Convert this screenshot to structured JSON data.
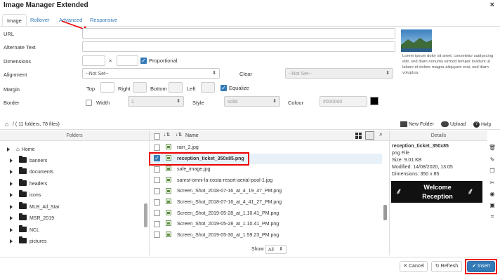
{
  "window": {
    "title": "Image Manager Extended",
    "close": "×"
  },
  "tabs": [
    {
      "label": "Image"
    },
    {
      "label": "Rollover"
    },
    {
      "label": "Advanced"
    },
    {
      "label": "Responsive"
    }
  ],
  "form": {
    "url_label": "URL",
    "alt_label": "Alternate Text",
    "dimensions_label": "Dimensions",
    "dim_separator": "×",
    "proportional_label": "Proportional",
    "alignment_label": "Alignment",
    "alignment_value": "--Not Set--",
    "clear_label": "Clear",
    "clear_value": "--Not Set--",
    "margin_label": "Margin",
    "margin_top": "Top",
    "margin_right": "Right",
    "margin_bottom": "Bottom",
    "margin_left": "Left",
    "equalize_label": "Equalize",
    "border_label": "Border",
    "width_label": "Width",
    "width_value": "1",
    "style_label": "Style",
    "style_value": "solid",
    "colour_label": "Colour",
    "colour_value": "#000000",
    "colour_swatch": "#000000"
  },
  "preview": {
    "text": "Lorem ipsum dolor sit amet, consetetur sadipscing elitr, sed diam nonumy eirmod tempor invidunt ut labore et dolore magna aliquyam erat, sed diam voluptua."
  },
  "browser": {
    "path": "/ ( 11 folders, 78 files)",
    "new_folder": "New Folder",
    "upload": "Upload",
    "help": "Help",
    "folders_header": "Folders",
    "name_header": "Name",
    "details_header": "Details",
    "show_label": "Show",
    "show_value": "All"
  },
  "folders": [
    {
      "label": "Home"
    },
    {
      "label": "banners"
    },
    {
      "label": "documents"
    },
    {
      "label": "headers"
    },
    {
      "label": "icons"
    },
    {
      "label": "MLB_All_Star"
    },
    {
      "label": "MSR_2019"
    },
    {
      "label": "NCL"
    },
    {
      "label": "pictures"
    }
  ],
  "files": [
    {
      "name": "rain_2.jpg"
    },
    {
      "name": "reception_ticket_350x85.png"
    },
    {
      "name": "safe_image.jpg"
    },
    {
      "name": "sanrst-omni-la-costa-resort-aerial-pool-1.jpg"
    },
    {
      "name": "Screen_Shot_2018-07-16_at_4_19_47_PM.png"
    },
    {
      "name": "Screen_Shot_2018-07-16_at_4_41_27_PM.png"
    },
    {
      "name": "Screen_Shot_2019-05-28_at_1.10.41_PM.png"
    },
    {
      "name": "Screen_Shot_2019-05-28_at_1.10.41_PM.png"
    },
    {
      "name": "Screen_Shot_2019-05-30_at_1.59.23_PM.png"
    }
  ],
  "details": {
    "filename": "reception_ticket_350x85",
    "type": "png File",
    "size": "Size: 9.01 KB",
    "modified": "Modified: 14/08/2020, 13:05",
    "dimensions": "Dimensions: 350 x 85",
    "thumb_line1": "Welcome",
    "thumb_line2": "Reception"
  },
  "footer": {
    "cancel": "Cancel",
    "refresh": "Refresh",
    "insert": "Insert"
  }
}
